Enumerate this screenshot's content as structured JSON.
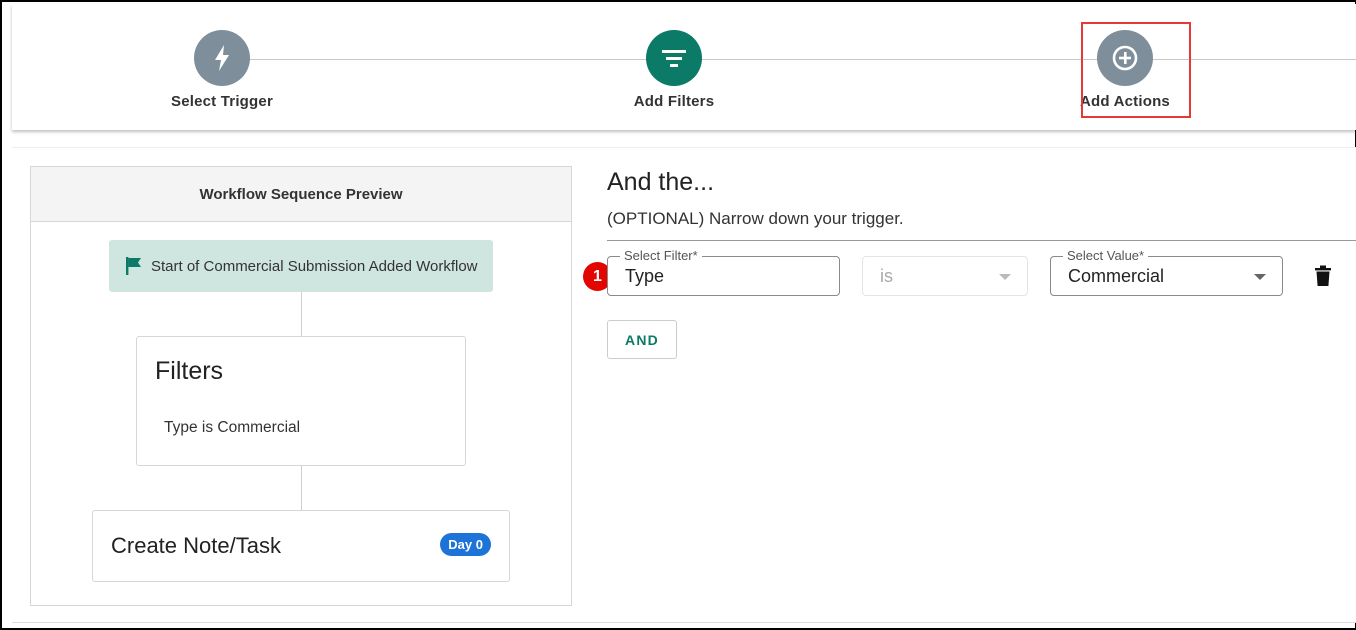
{
  "stepper": {
    "steps": [
      {
        "label": "Select Trigger",
        "icon": "lightning-icon",
        "state": "inactive"
      },
      {
        "label": "Add Filters",
        "icon": "filter-icon",
        "state": "active"
      },
      {
        "label": "Add Actions",
        "icon": "plus-circle-icon",
        "state": "inactive"
      }
    ]
  },
  "preview": {
    "title": "Workflow Sequence Preview",
    "start_node": "Start of Commercial Submission Added Workflow",
    "filters_title": "Filters",
    "filters_desc": "Type is Commercial",
    "task_title": "Create Note/Task",
    "task_badge": "Day 0"
  },
  "form": {
    "heading": "And the...",
    "subheading": "(OPTIONAL) Narrow down your trigger.",
    "marker": "1",
    "filter_label": "Select Filter*",
    "filter_value": "Type",
    "operator_value": "is",
    "value_label": "Select Value*",
    "value_value": "Commercial",
    "and_button": "AND"
  },
  "colors": {
    "accent_green": "#0b7a66",
    "step_gray": "#7e8f9b",
    "highlight_red": "#e53935",
    "badge_blue": "#1e73d8",
    "start_node_bg": "#cfe5e0"
  }
}
